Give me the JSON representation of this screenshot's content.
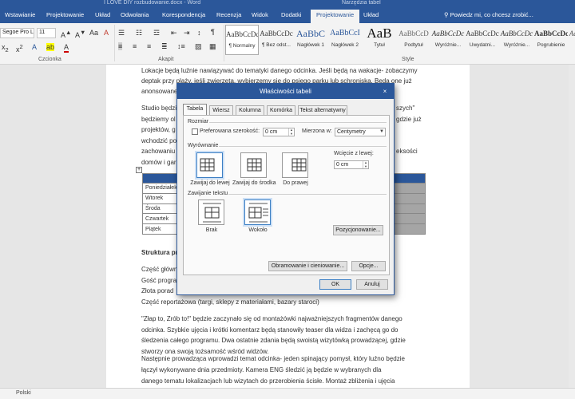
{
  "window": {
    "doc_title": "I LOVE DIY rozbudowanie.docx - Word",
    "tools_title": "Narzędzia tabel"
  },
  "ribbon_tabs": [
    "Wstawianie",
    "Projektowanie",
    "Układ",
    "Odwołania",
    "Korespondencja",
    "Recenzja",
    "Widok",
    "Dodatki",
    "Projektowanie",
    "Układ"
  ],
  "tell_me": "Powiedz mi, co chcesz zrobić...",
  "font": {
    "name": "Segoe Pro Ligh",
    "size": "11"
  },
  "group_labels": {
    "font": "Czcionka",
    "paragraph": "Akapit",
    "styles": "Style"
  },
  "styles": [
    {
      "preview": "AaBbCcDc",
      "name": "¶ Normalny"
    },
    {
      "preview": "AaBbCcDc",
      "name": "¶ Bez odst..."
    },
    {
      "preview": "AaBbC",
      "name": "Nagłówek 1"
    },
    {
      "preview": "AaBbCcI",
      "name": "Nagłówek 2"
    },
    {
      "preview": "AaB",
      "name": "Tytuł"
    },
    {
      "preview": "AaBbCcD",
      "name": "Podtytuł"
    },
    {
      "preview": "AaBbCcDc",
      "name": "Wyróżnie..."
    },
    {
      "preview": "AaBbCcDc",
      "name": "Uwydatni..."
    },
    {
      "preview": "AaBbCcDc",
      "name": "Wyróżnie..."
    },
    {
      "preview": "AaBbCcDc",
      "name": "Pogrubienie"
    },
    {
      "preview": "AaBbCcDc",
      "name": "Cytat"
    }
  ],
  "document": {
    "p1a": "Lokacje będą luźnie nawiązywać do tematyki danego odcinka. Jeśli będą na wakacje- zobaczymy",
    "p1b": "deptak przy plaży, jeśli zwierzęta, wybierzemy się do psiego parku lub schroniska. Będą one już",
    "p1c": "anonsowane",
    "p2_lines": [
      "Studio będzie",
      "będziemy ol",
      "projektów, g",
      "wchodzić po",
      "zachowaniu",
      "domów i gar"
    ],
    "p2_right": [
      "szych\"",
      "gdzie już",
      "",
      "",
      "eksości",
      ""
    ],
    "table_rows": [
      "Poniedziałek",
      "Wtorek",
      "Środa",
      "Czwartek",
      "Piątek"
    ],
    "heading": "Struktura pro",
    "list_lines": [
      "Część główn",
      "Gość progra",
      "Złota porad"
    ],
    "list_last": "Część reportażowa (targi, sklepy z materiałami, bazary staroci)",
    "p3": [
      "\"Złap to, Zrób to!\" będzie zaczynało się od montażówki najważniejszych fragmentów danego",
      "odcinka. Szybkie ujęcia i krótki komentarz będą stanowiły teaser dla widza i zachęcą go do",
      "śledzenia całego programu. Dwa ostatnie zdania będą swoistą wizytówką prowadzącej, gdzie",
      "stworzy ona swoją tożsamość wśród widzów."
    ],
    "p4": [
      "Następnie prowadząca wprowadzi temat odcinka- jeden spinający pomysł, który luźno będzie",
      "łączył wykonywane dnia przedmioty. Kamera ENG śledzić ją będzie w wybranych dla",
      "danego tematu lokalizacjach lub wizytach do przerobienia ścisłe. Montaż zbliżenia i ujęcia"
    ]
  },
  "status": {
    "language": "Polski"
  },
  "dialog": {
    "title": "Właściwości tabeli",
    "close": "×",
    "tabs": [
      "Tabela",
      "Wiersz",
      "Kolumna",
      "Komórka",
      "Tekst alternatywny"
    ],
    "size_label": "Rozmiar",
    "preferred_width": "Preferowana szerokość:",
    "width_value": "0 cm",
    "measure_label": "Mierzona w:",
    "measure_value": "Centymetry",
    "alignment_label": "Wyrównanie",
    "align_options": [
      "Zawijaj do lewej",
      "Zawijaj do środka",
      "Do prawej"
    ],
    "indent_label": "Wcięcie z lewej:",
    "indent_value": "0 cm",
    "wrap_label": "Zawijanie tekstu",
    "wrap_options": [
      "Brak",
      "Wokoło"
    ],
    "positioning_button": "Pozycjonowanie...",
    "borders_button": "Obramowanie i cieniowanie...",
    "options_button": "Opcje...",
    "ok_button": "OK",
    "cancel_button": "Anuluj"
  }
}
